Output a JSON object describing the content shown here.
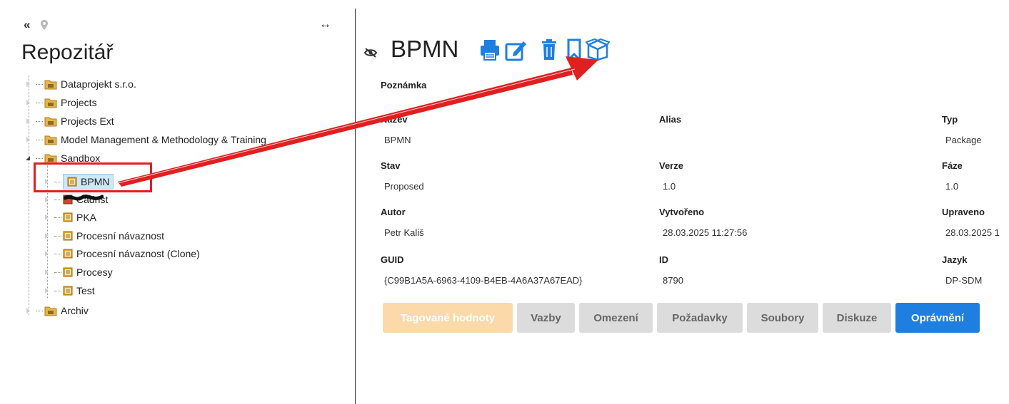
{
  "left_panel": {
    "collapse_label": "«",
    "resize_label": "↔",
    "title": "Repozitář",
    "tree": {
      "dataprojekt": "Dataprojekt s.r.o.",
      "projects": "Projects",
      "projects_ext": "Projects Ext",
      "model_mgmt": "Model Management & Methodology & Training",
      "sandbox": "Sandbox",
      "bpmn": "BPMN",
      "redacted": "Cadnst",
      "pka": "PKA",
      "procesni": "Procesní návaznost",
      "procesni_clone": "Procesní návaznost (Clone)",
      "procesy": "Procesy",
      "test": "Test",
      "archiv": "Archiv"
    }
  },
  "element": {
    "title": "BPMN",
    "toolbar_icons": [
      "print-icon",
      "edit-icon",
      "trash-icon",
      "bookmark-icon",
      "package-icon"
    ]
  },
  "details": {
    "poznamka_label": "Poznámka",
    "nazev_label": "Název",
    "nazev_value": "BPMN",
    "alias_label": "Alias",
    "typ_label": "Typ",
    "typ_value": "Package",
    "stav_label": "Stav",
    "stav_value": "Proposed",
    "verze_label": "Verze",
    "verze_value": "1.0",
    "faze_label": "Fáze",
    "faze_value": "1.0",
    "autor_label": "Autor",
    "autor_value": "Petr Kališ",
    "vytvoreno_label": "Vytvořeno",
    "vytvoreno_value": "28.03.2025 11:27:56",
    "upraveno_label": "Upraveno",
    "upraveno_value": "28.03.2025 1",
    "guid_label": "GUID",
    "guid_value": "{C99B1A5A-6963-4109-B4EB-4A6A37A67EAD}",
    "id_label": "ID",
    "id_value": "8790",
    "jazyk_label": "Jazyk",
    "jazyk_value": "DP-SDM"
  },
  "tabs": [
    "Tagované hodnoty",
    "Vazby",
    "Omezení",
    "Požadavky",
    "Soubory",
    "Diskuze",
    "Oprávnění"
  ],
  "colors": {
    "accent_blue": "#1e7fe0",
    "tab_active": "#fbd9a8",
    "annotation_red": "#e02020",
    "folder_yellow": "#e8b54a",
    "doc_orange": "#e2a72e"
  }
}
